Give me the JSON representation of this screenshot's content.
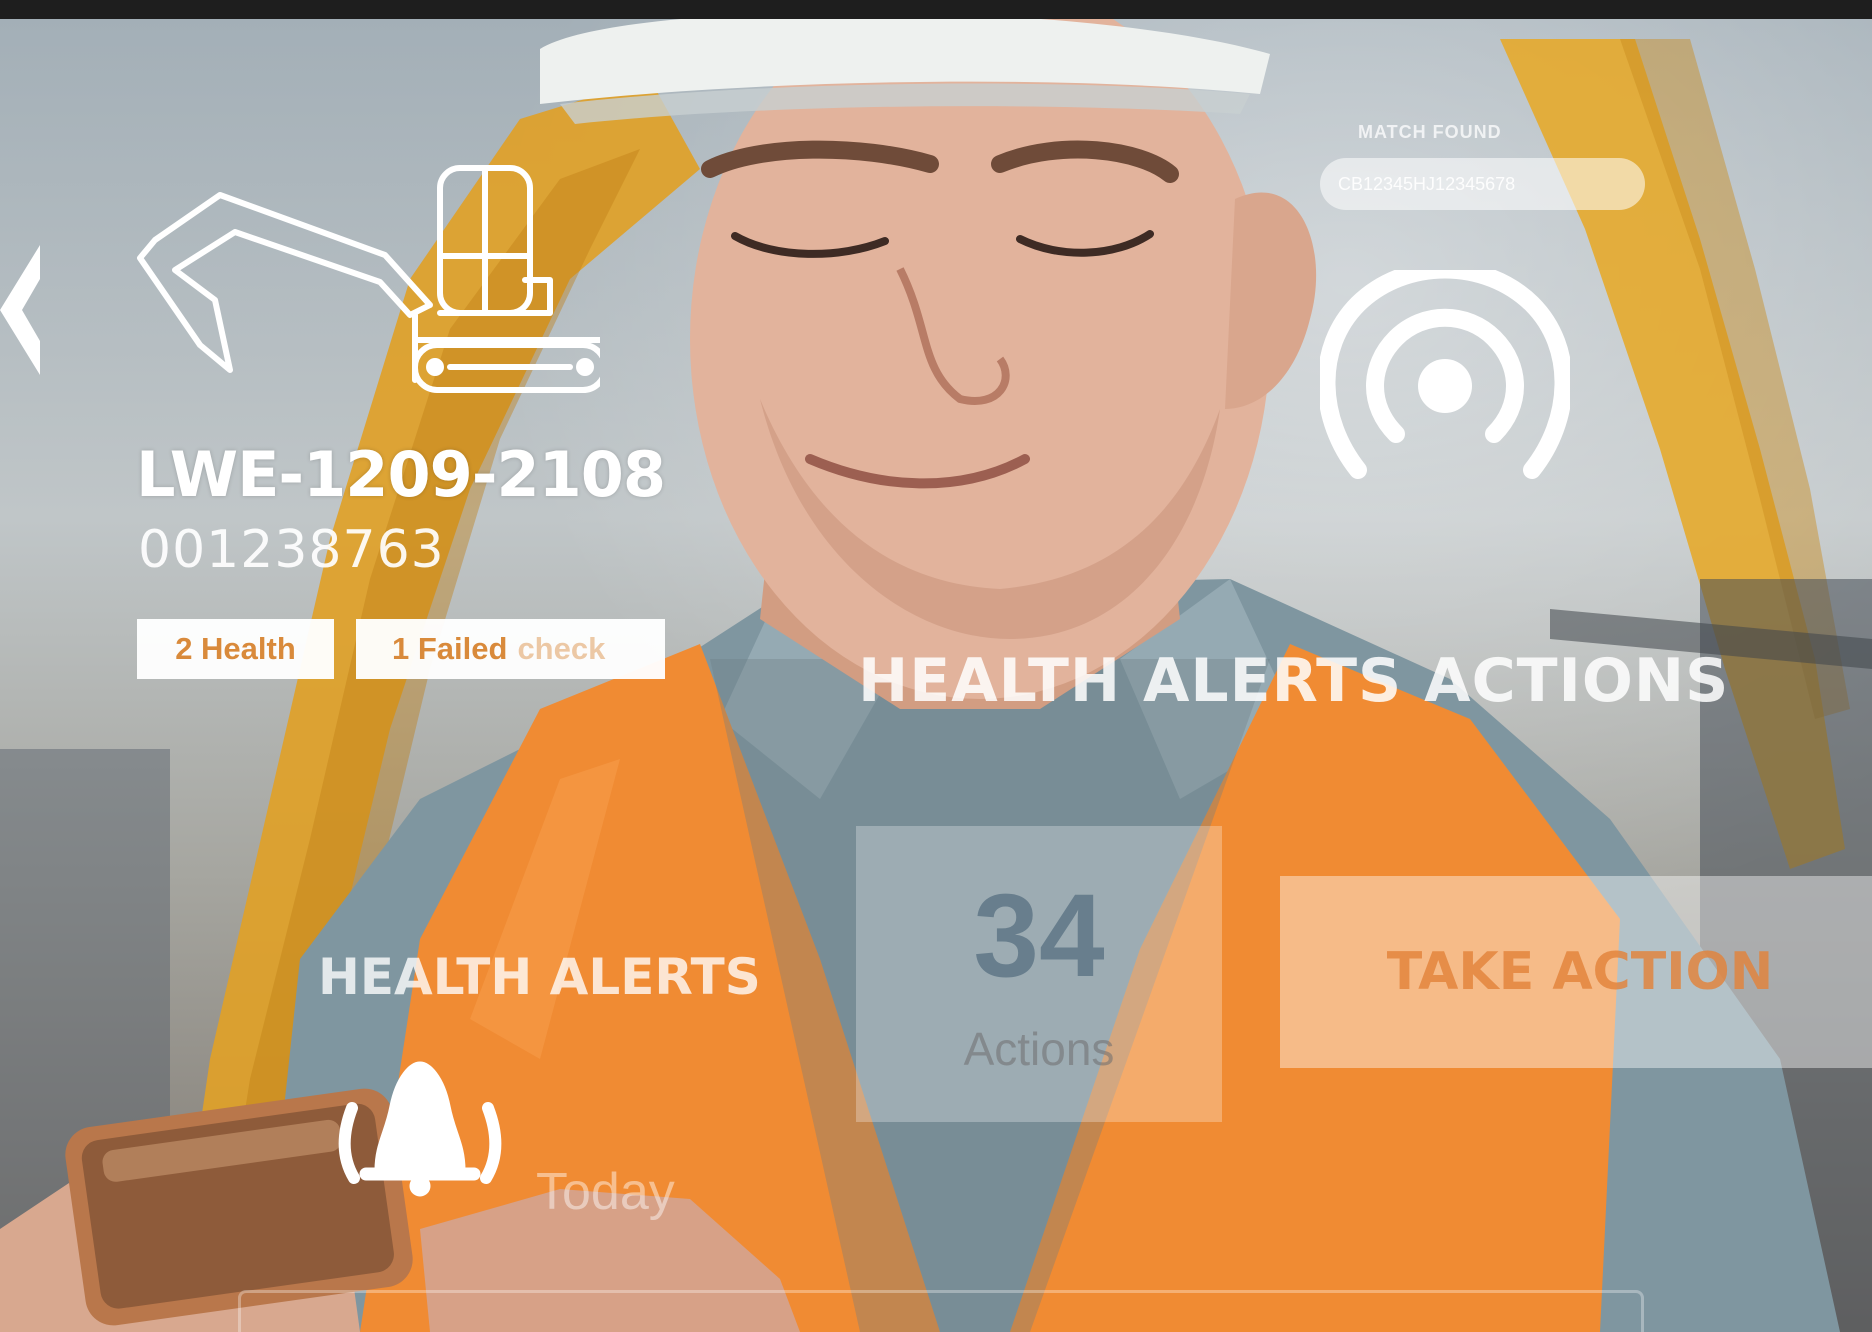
{
  "overlay": {
    "asset_id": "LWE-1209-2108",
    "asset_serial": "001238763",
    "badge_health": "2 Health",
    "badge_failed_main": "1 Failed",
    "badge_failed_rest": "check",
    "match_found_label": "MATCH FOUND",
    "match_code": "CB12345HJ12345678",
    "section_title": "HEALTH ALERTS ACTIONS",
    "health_alerts_label": "HEALTH ALERTS",
    "actions_count": "34",
    "actions_label": "Actions",
    "take_action_label": "TAKE ACTION",
    "today_label": "Today"
  },
  "icons": [
    "chevron-left-icon",
    "excavator-icon",
    "signal-icon",
    "bell-icon"
  ],
  "colors": {
    "accent": "#E2823A",
    "vest": "#F08C35",
    "background_excavator": "#E0A82A",
    "overlay_white": "#FFFFFF"
  }
}
